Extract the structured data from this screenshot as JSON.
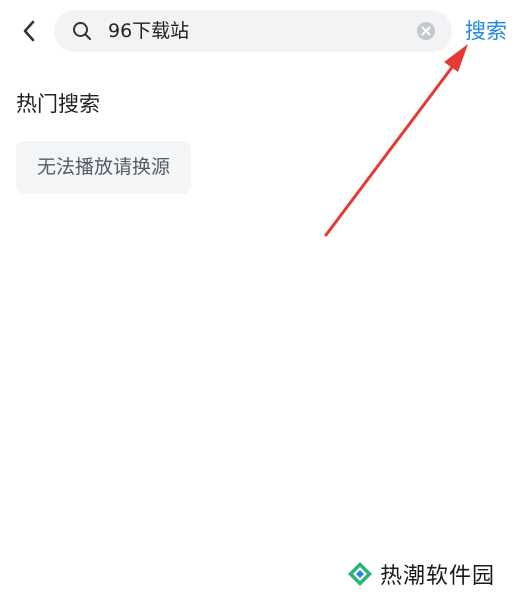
{
  "search": {
    "value": "96下载站",
    "action_label": "搜索"
  },
  "hot_search": {
    "title": "热门搜索",
    "tags": [
      "无法播放请换源"
    ]
  },
  "watermark": {
    "text": "热潮软件园"
  },
  "colors": {
    "accent": "#1e88e5",
    "annotation_arrow": "#e53935",
    "search_box_bg": "#f2f3f5",
    "tag_bg": "#f4f5f7"
  },
  "icons": {
    "back": "chevron-left-icon",
    "search": "search-icon",
    "clear": "clear-circle-icon",
    "watermark_logo": "diamond-logo-icon"
  }
}
